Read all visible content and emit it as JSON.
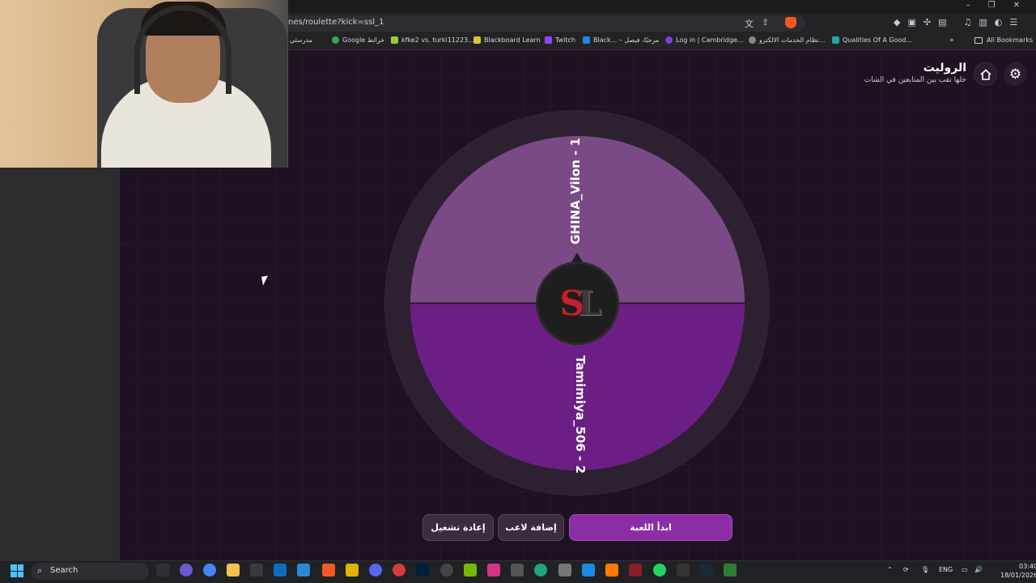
{
  "browser": {
    "url": "nes/roulette?kick=ssl_1",
    "bookmarks": [
      {
        "label": "مدرستي | الـ",
        "color": "#3b7ddd"
      },
      {
        "label": "Google خرائط",
        "color": "#34a853"
      },
      {
        "label": "kfke2 vs. turki11223...",
        "color": "#9acd32"
      },
      {
        "label": "Blackboard Learn",
        "color": "#e0c03a"
      },
      {
        "label": "Twitch",
        "color": "#9146ff"
      },
      {
        "label": "Black... – مرحبًا، فيصل",
        "color": "#1e88e5"
      },
      {
        "label": "Log in | Cambridge...",
        "color": "#7b3fe4"
      },
      {
        "label": "نظام الخدمات الالكترو...",
        "color": "#888888"
      },
      {
        "label": "Qualities Of A Good...",
        "color": "#26a69a"
      }
    ],
    "all_bookmarks": "All Bookmarks"
  },
  "page": {
    "title": "الروليت",
    "subtitle": "خلها تقب بين المتابعين في الشات"
  },
  "wheel": {
    "segments": [
      {
        "label": "GHINA_Vilon - 1",
        "color": "#7a4a86"
      },
      {
        "label": "Tamimiya_506 - 2",
        "color": "#6b1f84"
      }
    ],
    "logo_letters": [
      "S",
      "L"
    ]
  },
  "buttons": {
    "start": "ابدأ اللعبة",
    "add_player": "إضافة لاعب",
    "restart": "إعادة تشغيل"
  },
  "taskbar": {
    "search_placeholder": "Search",
    "language": "ENG",
    "time": "03:40",
    "date": "18/01/2026"
  }
}
